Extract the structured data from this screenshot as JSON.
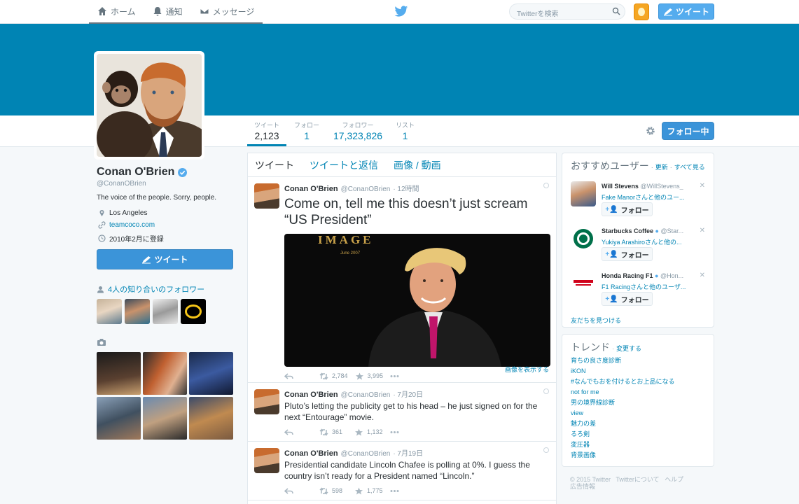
{
  "topnav": {
    "home": "ホーム",
    "notifications": "通知",
    "messages": "メッセージ",
    "search_placeholder": "Twitterを検索",
    "tweet_button": "ツイート"
  },
  "stats": [
    {
      "label": "ツイート",
      "value": "2,123"
    },
    {
      "label": "フォロー",
      "value": "1"
    },
    {
      "label": "フォロワー",
      "value": "17,323,826"
    },
    {
      "label": "リスト",
      "value": "1"
    }
  ],
  "following_button": "フォロー中",
  "profile": {
    "name": "Conan O'Brien",
    "handle": "@ConanOBrien",
    "bio": "The voice of the people. Sorry, people.",
    "location": "Los Angeles",
    "website": "teamcoco.com",
    "joined": "2010年2月に登録",
    "tweet_button": "ツイート",
    "known_followers": "4人の知り合いのフォロワー"
  },
  "timeline": {
    "tabs": [
      "ツイート",
      "ツイートと返信",
      "画像 / 動画"
    ],
    "tweets": [
      {
        "name": "Conan O'Brien",
        "handle": "@ConanOBrien",
        "time": "· 12時間",
        "text": "Come on, tell me this doesn’t just scream “US President”",
        "retweets": "2,784",
        "likes": "3,995",
        "media_title": "IMAGE",
        "media_date": "June 2007",
        "show_image": "画像を表示する"
      },
      {
        "name": "Conan O'Brien",
        "handle": "@ConanOBrien",
        "time": "· 7月20日",
        "text": "Pluto’s letting the publicity get to his head – he just signed on for the next “Entourage” movie.",
        "retweets": "361",
        "likes": "1,132"
      },
      {
        "name": "Conan O'Brien",
        "handle": "@ConanOBrien",
        "time": "· 7月19日",
        "text": "Presidential candidate Lincoln Chafee is polling at 0%. I guess the country isn’t ready for a President named “Lincoln.”",
        "retweets": "598",
        "likes": "1,775"
      }
    ]
  },
  "suggestions": {
    "title": "おすすめユーザー",
    "refresh": "更新",
    "view_all": "すべて見る",
    "follow_label": "フォロー",
    "items": [
      {
        "name": "Will Stevens",
        "handle": "@WillStevens_",
        "context": "Fake Manorさんと他のユー..."
      },
      {
        "name": "Starbucks Coffee",
        "handle": "@Star...",
        "context": "Yukiya Arashiroさんと他の..."
      },
      {
        "name": "Honda Racing F1",
        "handle": "@Hon...",
        "context": "F1 Racingさんと他のユーザ..."
      }
    ],
    "find_friends": "友だちを見つける"
  },
  "trends": {
    "title": "トレンド",
    "change": "変更する",
    "items": [
      "育ちの良さ度診断",
      "iKON",
      "#なんでもおを付けるとお上品になる",
      "not for me",
      "男の境界線診断",
      "view",
      "魅力の差",
      "るろ剣",
      "変圧器",
      "背景画像"
    ]
  },
  "footer": {
    "copyright": "© 2015 Twitter",
    "about": "Twitterについて",
    "help": "ヘルプ",
    "ads": "広告情報"
  },
  "colors": {
    "link": "#0084b4",
    "banner": "#0084b4",
    "button": "#3b94d9"
  }
}
